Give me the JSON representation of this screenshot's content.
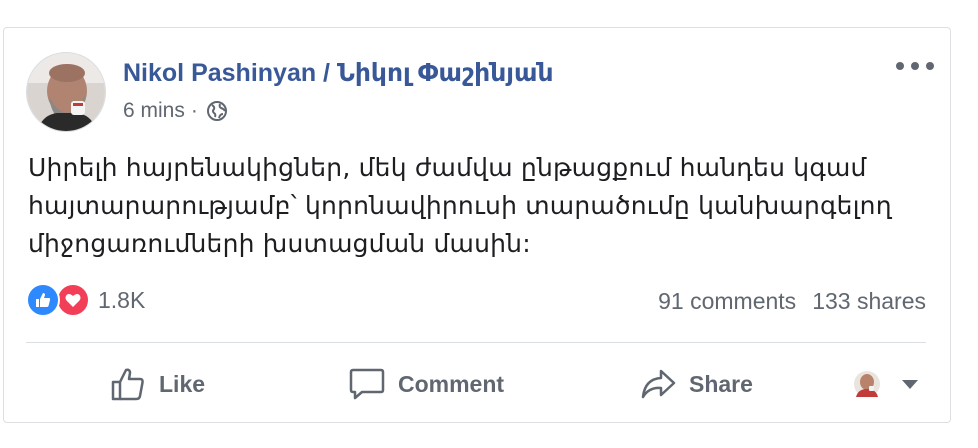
{
  "post": {
    "author": "Nikol Pashinyan / Նիկոլ Փաշինյան",
    "time": "6 mins",
    "separator": "·",
    "audience_icon": "globe-icon",
    "body_lines": [
      "Սիրելի հայրենակիցներ, մեկ ժամվա ընթացքում հանդես կգամ",
      "հայտարարությամբ՝ կորոնավիրուսի տարածումը կանխարգելող",
      "միջոցառումների խստացման մասին:"
    ]
  },
  "reactions": {
    "types": [
      "like",
      "love"
    ],
    "count": "1.8K",
    "comments": "91 comments",
    "shares": "133 shares"
  },
  "actions": {
    "like": "Like",
    "comment": "Comment",
    "share": "Share"
  },
  "colors": {
    "author": "#385898",
    "muted": "#606770",
    "text": "#1c1e21",
    "like_blue": "#2e89ff",
    "love_red": "#f33e58"
  }
}
